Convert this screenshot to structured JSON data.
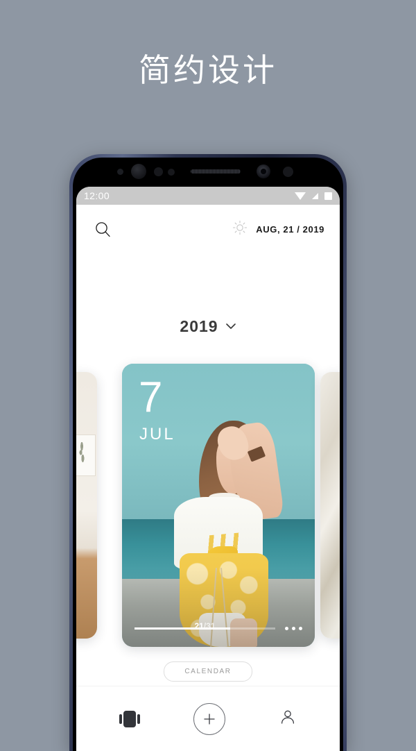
{
  "page": {
    "headline": "简约设计",
    "background_color": "#8e97a3"
  },
  "phone": {
    "frame_color": "#2d3450",
    "statusbar": {
      "time": "12:00",
      "icons": [
        "wifi-icon",
        "signal-icon",
        "battery-icon"
      ]
    }
  },
  "app": {
    "appbar": {
      "search_icon": "search-icon",
      "weather_icon": "sun-icon",
      "date": "AUG, 21 / 2019"
    },
    "year_selector": {
      "year": "2019",
      "chevron": "chevron-down-icon"
    },
    "carousel": {
      "active_card": {
        "day": "7",
        "month": "JUL",
        "progress_current": "21",
        "progress_separator": "/",
        "progress_total": "31",
        "progress_percent": 68,
        "more_icon": "more-dots-icon",
        "accent_color": "#7fc0c4"
      },
      "peek_left": {
        "label": "previous-card"
      },
      "peek_right": {
        "label": "next-card"
      }
    },
    "calendar_button": {
      "label": "CALENDAR"
    },
    "bottom_nav": [
      {
        "name": "cards-icon",
        "label": "cards"
      },
      {
        "name": "add-icon",
        "label": "+"
      },
      {
        "name": "profile-icon",
        "label": "profile"
      }
    ]
  }
}
